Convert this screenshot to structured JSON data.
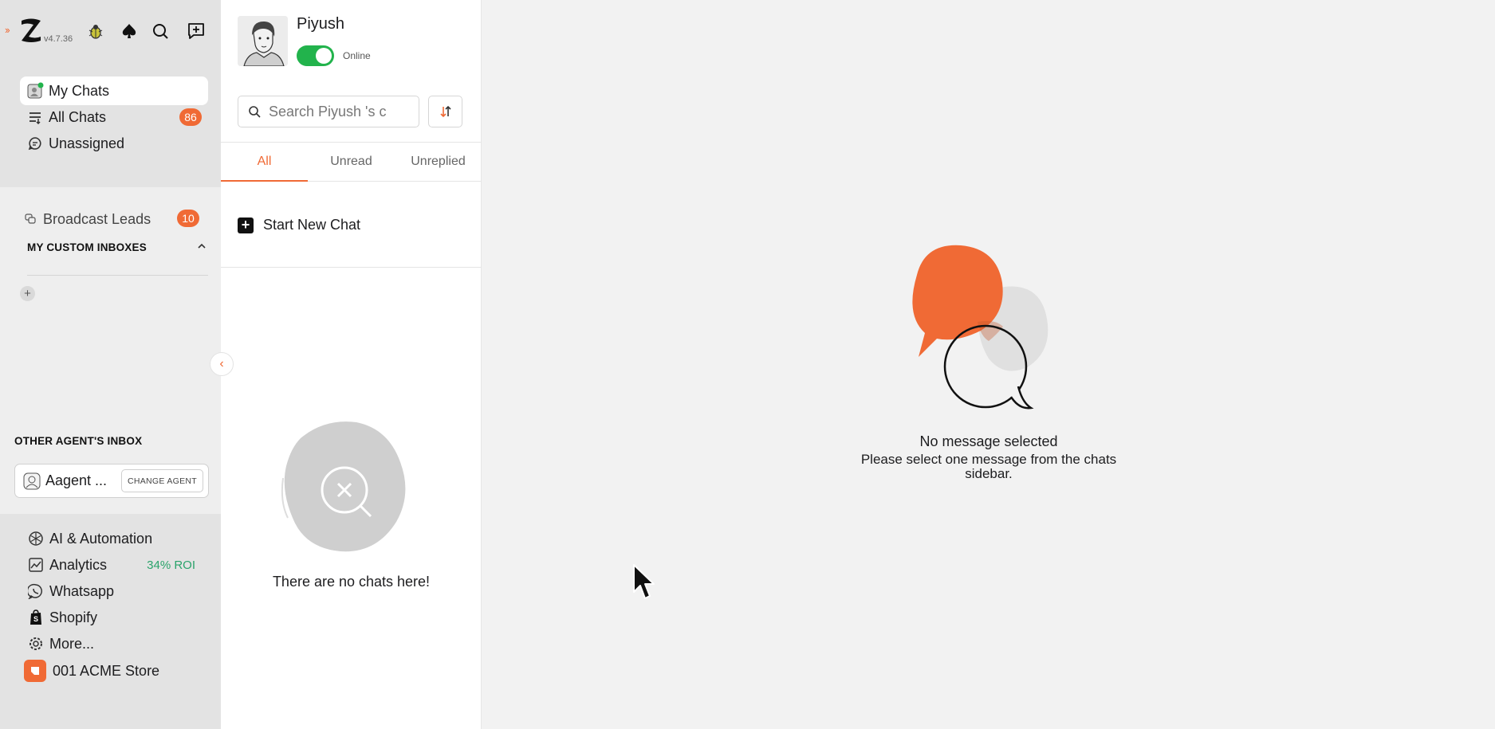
{
  "app": {
    "version": "v4.7.36",
    "expand_glyph": "››",
    "icons": [
      "logo-icon",
      "bug-icon",
      "spade-icon",
      "search-icon",
      "new-chat-icon"
    ]
  },
  "sidebar": {
    "nav": [
      {
        "label": "My Chats",
        "icon": "my-chats-icon",
        "active": true
      },
      {
        "label": "All Chats",
        "icon": "list-icon",
        "badge": "86"
      },
      {
        "label": "Unassigned",
        "icon": "chat-bubble-icon"
      }
    ],
    "broadcast": {
      "label": "Broadcast Leads",
      "badge": "10"
    },
    "custom_inboxes_heading": "MY CUSTOM INBOXES",
    "add_inbox": "+",
    "other_agent_heading": "OTHER AGENT'S INBOX",
    "agent_name": "Aagent ...",
    "change_agent_label": "CHANGE AGENT",
    "bottom": [
      {
        "label": "AI & Automation",
        "icon": "ai-icon"
      },
      {
        "label": "Analytics",
        "icon": "analytics-icon",
        "extra": "34% ROI"
      },
      {
        "label": "Whatsapp",
        "icon": "whatsapp-icon"
      },
      {
        "label": "Shopify",
        "icon": "shopify-icon"
      },
      {
        "label": "More...",
        "icon": "gear-icon"
      }
    ],
    "store_label": "001 ACME Store",
    "collapse_glyph": "‹"
  },
  "chatlist": {
    "user_name": "Piyush",
    "status": "Online",
    "search_placeholder": "Search Piyush 's c",
    "tabs": [
      {
        "label": "All",
        "active": true
      },
      {
        "label": "Unread"
      },
      {
        "label": "Unreplied"
      }
    ],
    "new_chat_label": "Start New Chat",
    "new_chat_glyph": "+",
    "empty_text": "There are no chats here!"
  },
  "main": {
    "title": "No message selected",
    "subtitle": "Please select one message from the chats sidebar."
  },
  "colors": {
    "accent": "#f06a35",
    "online": "#22b34c",
    "roi": "#2aa36b"
  }
}
